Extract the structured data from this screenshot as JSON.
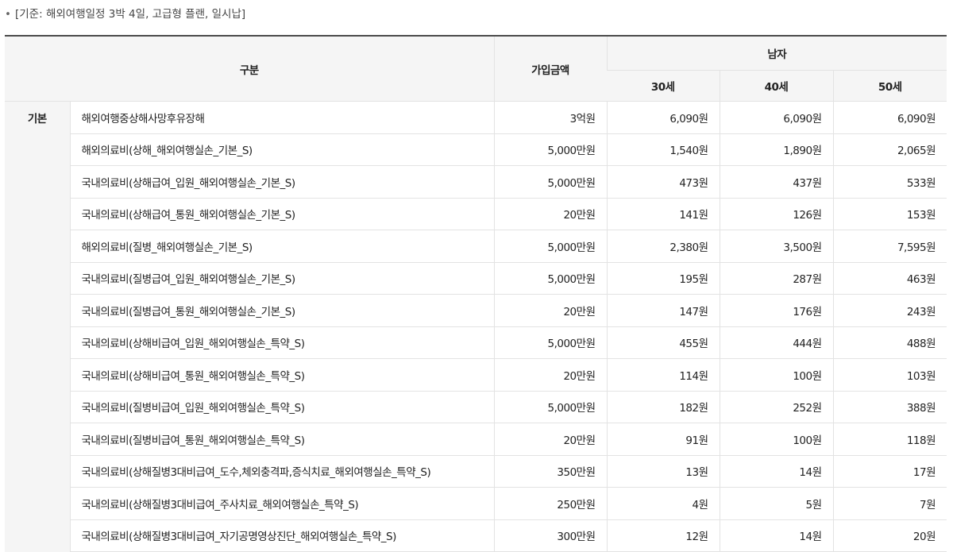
{
  "note": "[기준: 해외여행일정 3박 4일, 고급형 플랜, 일시납]",
  "headers": {
    "category": "구분",
    "amount": "가입금액",
    "gender": "남자",
    "ages": [
      "30세",
      "40세",
      "50세"
    ]
  },
  "group_label": "기본",
  "rows": [
    {
      "name": "해외여행중상해사망후유장해",
      "amount": "3억원",
      "a30": "6,090원",
      "a40": "6,090원",
      "a50": "6,090원"
    },
    {
      "name": "해외의료비(상해_해외여행실손_기본_S)",
      "amount": "5,000만원",
      "a30": "1,540원",
      "a40": "1,890원",
      "a50": "2,065원"
    },
    {
      "name": "국내의료비(상해급여_입원_해외여행실손_기본_S)",
      "amount": "5,000만원",
      "a30": "473원",
      "a40": "437원",
      "a50": "533원"
    },
    {
      "name": "국내의료비(상해급여_통원_해외여행실손_기본_S)",
      "amount": "20만원",
      "a30": "141원",
      "a40": "126원",
      "a50": "153원"
    },
    {
      "name": "해외의료비(질병_해외여행실손_기본_S)",
      "amount": "5,000만원",
      "a30": "2,380원",
      "a40": "3,500원",
      "a50": "7,595원"
    },
    {
      "name": "국내의료비(질병급여_입원_해외여행실손_기본_S)",
      "amount": "5,000만원",
      "a30": "195원",
      "a40": "287원",
      "a50": "463원"
    },
    {
      "name": "국내의료비(질병급여_통원_해외여행실손_기본_S)",
      "amount": "20만원",
      "a30": "147원",
      "a40": "176원",
      "a50": "243원"
    },
    {
      "name": "국내의료비(상해비급여_입원_해외여행실손_특약_S)",
      "amount": "5,000만원",
      "a30": "455원",
      "a40": "444원",
      "a50": "488원"
    },
    {
      "name": "국내의료비(상해비급여_통원_해외여행실손_특약_S)",
      "amount": "20만원",
      "a30": "114원",
      "a40": "100원",
      "a50": "103원"
    },
    {
      "name": "국내의료비(질병비급여_입원_해외여행실손_특약_S)",
      "amount": "5,000만원",
      "a30": "182원",
      "a40": "252원",
      "a50": "388원"
    },
    {
      "name": "국내의료비(질병비급여_통원_해외여행실손_특약_S)",
      "amount": "20만원",
      "a30": "91원",
      "a40": "100원",
      "a50": "118원"
    },
    {
      "name": "국내의료비(상해질병3대비급여_도수,체외충격파,증식치료_해외여행실손_특약_S)",
      "amount": "350만원",
      "a30": "13원",
      "a40": "14원",
      "a50": "17원"
    },
    {
      "name": "국내의료비(상해질병3대비급여_주사치료_해외여행실손_특약_S)",
      "amount": "250만원",
      "a30": "4원",
      "a40": "5원",
      "a50": "7원"
    },
    {
      "name": "국내의료비(상해질병3대비급여_자기공명영상진단_해외여행실손_특약_S)",
      "amount": "300만원",
      "a30": "12원",
      "a40": "14원",
      "a50": "20원"
    }
  ]
}
